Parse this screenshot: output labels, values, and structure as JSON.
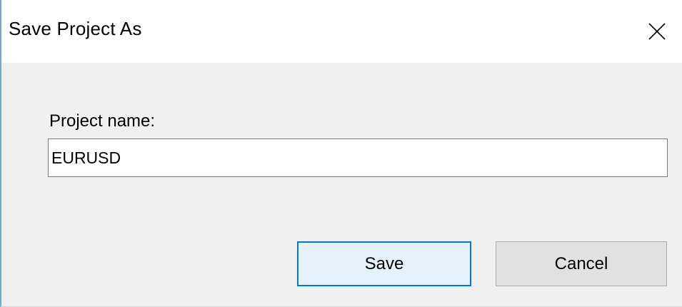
{
  "window": {
    "title": "Save Project As",
    "close_icon": "close-icon"
  },
  "form": {
    "project_name_label": "Project name:",
    "project_name_value": "EURUSD"
  },
  "buttons": {
    "save_label": "Save",
    "cancel_label": "Cancel"
  },
  "colors": {
    "accent": "#0078d7",
    "default_button_bg": "#e5f1fb",
    "dialog_bg": "#f0f0f0"
  }
}
